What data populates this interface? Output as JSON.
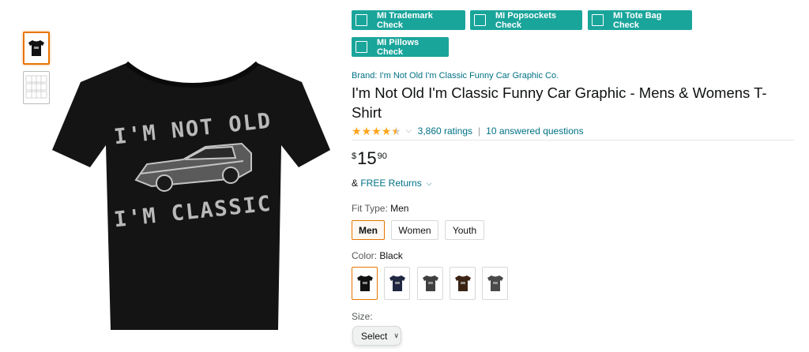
{
  "thumbnails": [
    "tshirt-thumbnail",
    "size-chart-thumbnail"
  ],
  "main_image": {
    "line1": "I'M NOT OLD",
    "line2": "I'M CLASSIC"
  },
  "mi_buttons": [
    {
      "label": "MI Trademark Check"
    },
    {
      "label": "MI Popsockets Check"
    },
    {
      "label": "MI Tote Bag Check"
    },
    {
      "label": "MI Pillows Check"
    }
  ],
  "product": {
    "brand": "Brand: I'm Not Old I'm Classic Funny Car Graphic Co.",
    "title": "I'm Not Old I'm Classic Funny Car Graphic - Mens & Womens T-Shirt",
    "rating": 4.5,
    "ratings_count": "3,860 ratings",
    "answered": "10 answered questions",
    "price": {
      "currency": "$",
      "whole": "15",
      "fraction": "90"
    },
    "returns_prefix": "& ",
    "returns": "FREE Returns"
  },
  "fit_type": {
    "label": "Fit Type:",
    "selected": "Men",
    "options": [
      "Men",
      "Women",
      "Youth"
    ]
  },
  "color": {
    "label": "Color:",
    "selected": "Black",
    "swatches": [
      {
        "name": "Black",
        "hex": "#111111"
      },
      {
        "name": "Navy",
        "hex": "#1f2741"
      },
      {
        "name": "Asphalt",
        "hex": "#3f3f3f"
      },
      {
        "name": "Brown",
        "hex": "#3b2314"
      },
      {
        "name": "Heather Grey",
        "hex": "#4a4a4a"
      }
    ]
  },
  "size": {
    "label": "Size:",
    "select_label": "Select"
  },
  "colors": {
    "teal": "#1aa59b",
    "link": "#007185",
    "star": "#ffa41c",
    "selected_border": "#e77600"
  }
}
